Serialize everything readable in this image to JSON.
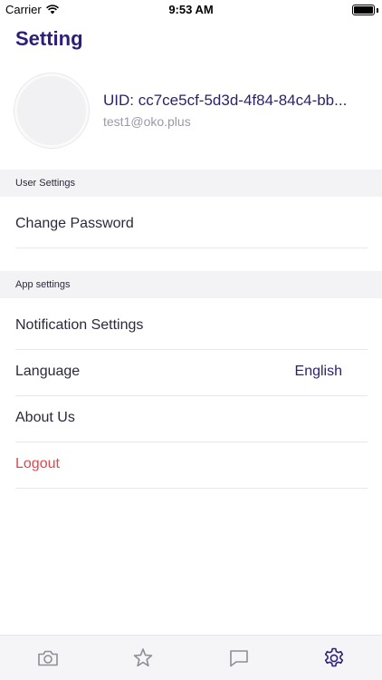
{
  "status_bar": {
    "carrier": "Carrier",
    "time": "9:53 AM"
  },
  "header": {
    "title": "Setting"
  },
  "profile": {
    "uid": "UID: cc7ce5cf-5d3d-4f84-84c4-bb...",
    "email": "test1@oko.plus"
  },
  "sections": {
    "user": {
      "header": "User Settings",
      "items": [
        {
          "label": "Change Password"
        }
      ]
    },
    "app": {
      "header": "App settings",
      "items": [
        {
          "label": "Notification Settings"
        },
        {
          "label": "Language",
          "value": "English"
        },
        {
          "label": "About Us"
        },
        {
          "label": "Logout"
        }
      ]
    }
  },
  "tab_bar": {
    "tabs": [
      {
        "icon": "camera-icon"
      },
      {
        "icon": "star-icon"
      },
      {
        "icon": "chat-icon"
      },
      {
        "icon": "gear-icon",
        "active": true
      }
    ]
  },
  "colors": {
    "accent": "#2c1f7a",
    "danger": "#e0474c",
    "inactive_icon": "#8e8e98",
    "section_bg": "#f3f3f5"
  }
}
